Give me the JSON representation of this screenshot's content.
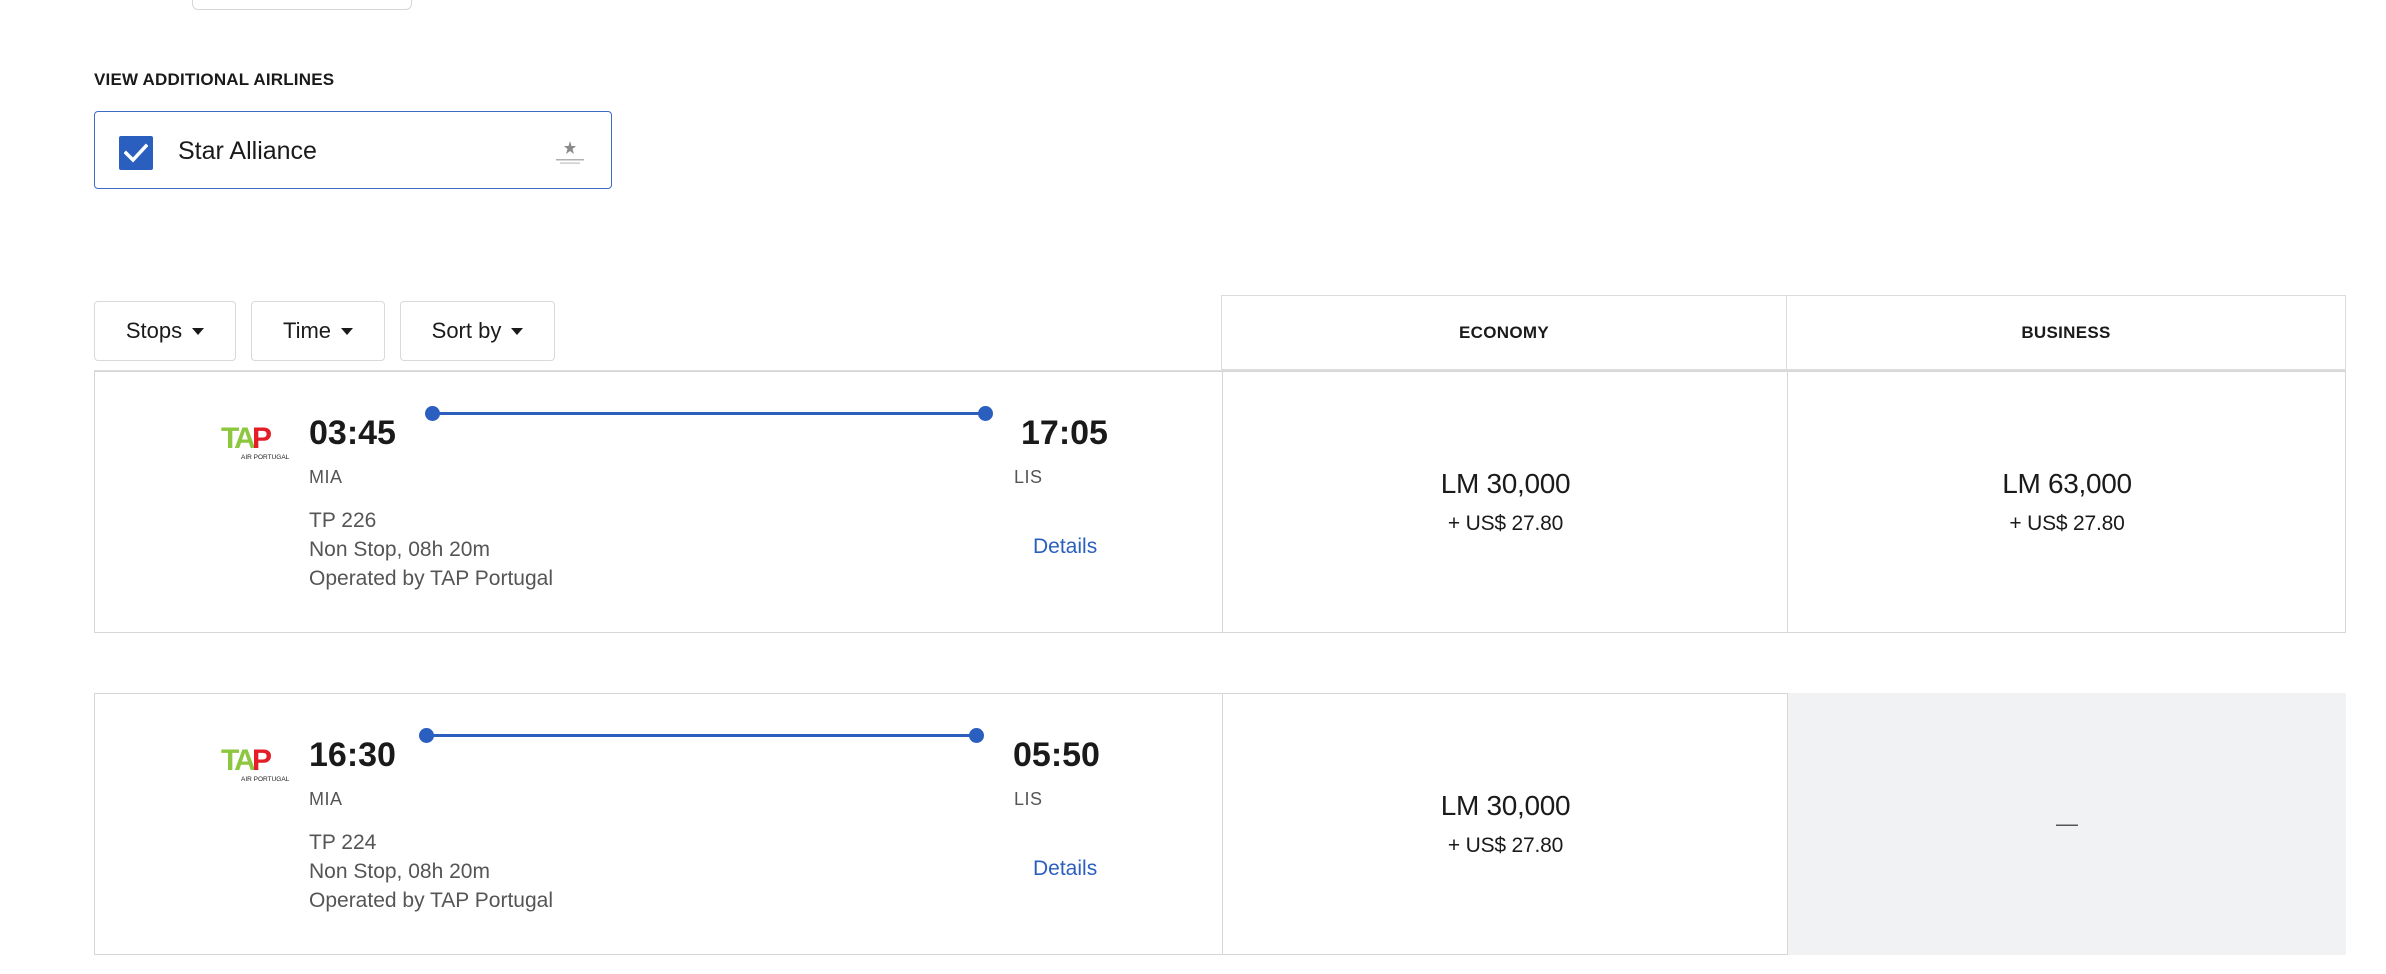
{
  "additional_airlines": {
    "section_label": "VIEW ADDITIONAL AIRLINES",
    "option_label": "Star Alliance",
    "checked": true,
    "logo_icon": "star-alliance-logo"
  },
  "filters": {
    "stops_label": "Stops",
    "time_label": "Time",
    "sort_label": "Sort by"
  },
  "columns": {
    "economy": "ECONOMY",
    "business": "BUSINESS"
  },
  "colors": {
    "accent": "#2b5fbf",
    "unavailable_bg": "#f1f2f4",
    "tap_green": "#8dc63f",
    "tap_red": "#e41e26"
  },
  "flights": [
    {
      "airline_logo": "tap-air-portugal-logo",
      "depart_time": "03:45",
      "depart_airport": "MIA",
      "arrive_time": "17:05",
      "arrive_airport": "LIS",
      "flight_number": "TP 226",
      "duration": "Non Stop, 08h 20m",
      "operated_by": "Operated by TAP Portugal",
      "details_label": "Details",
      "economy": {
        "miles": "LM 30,000",
        "taxes": "+ US$ 27.80"
      },
      "business": {
        "miles": "LM 63,000",
        "taxes": "+ US$ 27.80"
      }
    },
    {
      "airline_logo": "tap-air-portugal-logo",
      "depart_time": "16:30",
      "depart_airport": "MIA",
      "arrive_time": "05:50",
      "arrive_airport": "LIS",
      "flight_number": "TP 224",
      "duration": "Non Stop, 08h 20m",
      "operated_by": "Operated by TAP Portugal",
      "details_label": "Details",
      "economy": {
        "miles": "LM 30,000",
        "taxes": "+ US$ 27.80"
      },
      "business": {
        "unavailable_text": "—"
      }
    }
  ]
}
